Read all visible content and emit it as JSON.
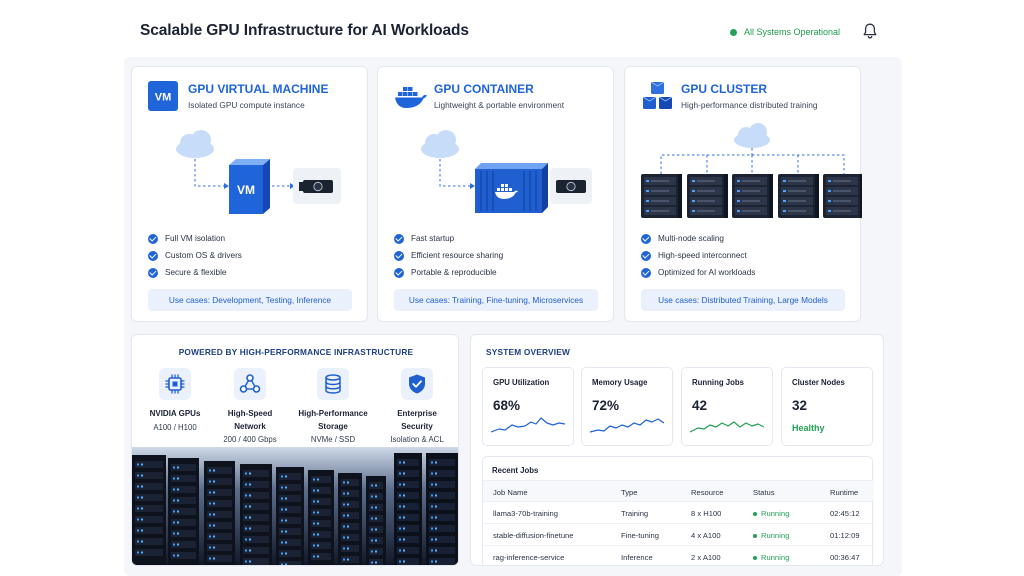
{
  "header": {
    "title": "Scalable GPU Infrastructure for AI Workloads",
    "status": "All Systems Operational"
  },
  "products": [
    {
      "title": "GPU VIRTUAL MACHINE",
      "subtitle": "Isolated GPU compute instance",
      "icon": "vm-icon",
      "icon_text": "VM",
      "illustration_label": "VM",
      "features": [
        "Full VM isolation",
        "Custom OS & drivers",
        "Secure & flexible"
      ],
      "use_cases": "Use cases: Development, Testing, Inference"
    },
    {
      "title": "GPU CONTAINER",
      "subtitle": "Lightweight & portable environment",
      "icon": "docker-whale-icon",
      "features": [
        "Fast startup",
        "Efficient resource sharing",
        "Portable & reproducible"
      ],
      "use_cases": "Use cases: Training, Fine-tuning, Microservices"
    },
    {
      "title": "GPU CLUSTER",
      "subtitle": "High-performance distributed training",
      "icon": "cubes-cluster-icon",
      "features": [
        "Multi-node scaling",
        "High-speed interconnect",
        "Optimized for AI workloads"
      ],
      "use_cases": "Use cases: Distributed Training, Large Models"
    }
  ],
  "infrastructure": {
    "title": "POWERED BY HIGH-PERFORMANCE INFRASTRUCTURE",
    "items": [
      {
        "name": "NVIDIA GPUs",
        "detail": "A100 / H100",
        "icon": "gpu-chip-icon"
      },
      {
        "name": "High-Speed Network",
        "detail": "200 / 400 Gbps",
        "icon": "network-nodes-icon"
      },
      {
        "name": "High-Performance Storage",
        "detail": "NVMe / SSD",
        "icon": "database-icon"
      },
      {
        "name": "Enterprise Security",
        "detail": "Isolation & ACL",
        "icon": "shield-check-icon"
      }
    ]
  },
  "overview": {
    "title": "SYSTEM OVERVIEW",
    "metrics": [
      {
        "label": "GPU Utilization",
        "value": "68%"
      },
      {
        "label": "Memory Usage",
        "value": "72%"
      },
      {
        "label": "Running Jobs",
        "value": "42"
      },
      {
        "label": "Cluster Nodes",
        "value": "32",
        "status": "Healthy"
      }
    ],
    "recent_jobs": {
      "title": "Recent Jobs",
      "columns": [
        "Job Name",
        "Type",
        "Resource",
        "Status",
        "Runtime"
      ],
      "rows": [
        [
          "llama3-70b-training",
          "Training",
          "8 x H100",
          "Running",
          "02:45:12"
        ],
        [
          "stable-diffusion-finetune",
          "Fine-tuning",
          "4 x A100",
          "Running",
          "01:12:09"
        ],
        [
          "rag-inference-service",
          "Inference",
          "2 x A100",
          "Running",
          "00:36:47"
        ]
      ]
    }
  },
  "colors": {
    "accent": "#1f64d8",
    "success": "#22a055",
    "title": "#1c3f86",
    "background": "#f4f6fa"
  }
}
